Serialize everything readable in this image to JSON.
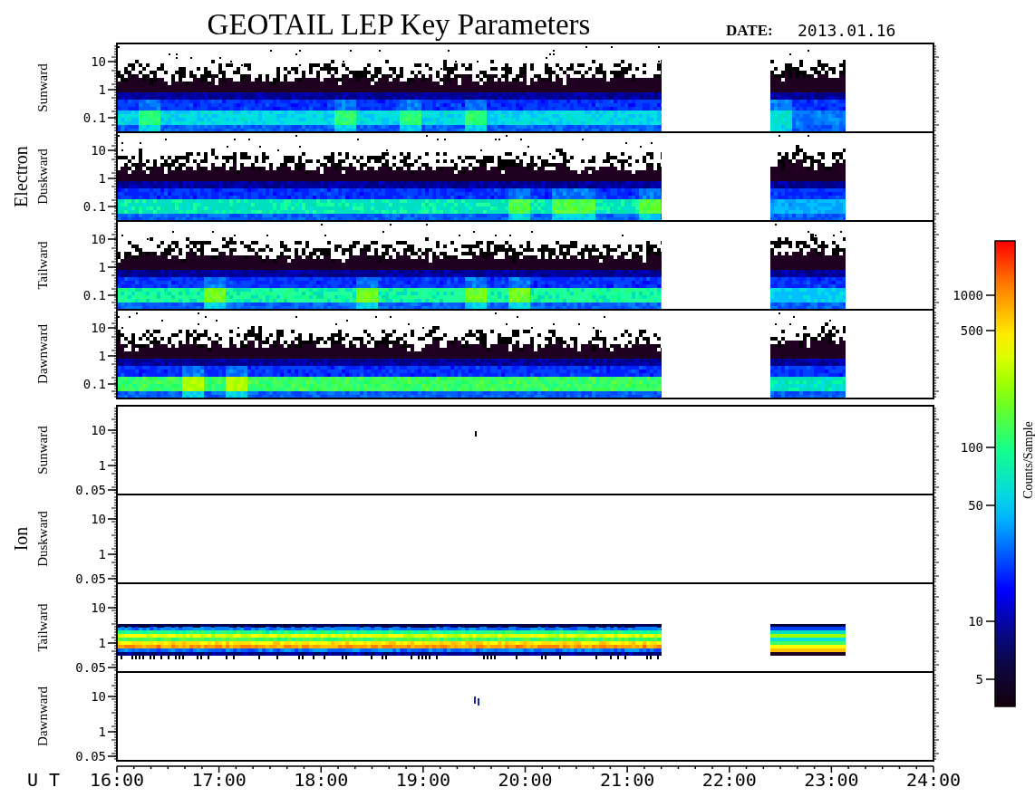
{
  "title": "GEOTAIL LEP Key Parameters",
  "date_label": "DATE:",
  "date": "2013.01.16",
  "groups": [
    {
      "label": "Electron",
      "panels": [
        {
          "label": "Sunward",
          "yticks": [
            "10",
            "1",
            "0.1"
          ]
        },
        {
          "label": "Duskward",
          "yticks": [
            "10",
            "1",
            "0.1"
          ]
        },
        {
          "label": "Tailward",
          "yticks": [
            "10",
            "1",
            "0.1"
          ]
        },
        {
          "label": "Dawnward",
          "yticks": [
            "10",
            "1",
            "0.1"
          ]
        }
      ]
    },
    {
      "label": "Ion",
      "panels": [
        {
          "label": "Sunward",
          "yticks": [
            "10",
            "1",
            "0.05"
          ]
        },
        {
          "label": "Duskward",
          "yticks": [
            "10",
            "1",
            "0.05"
          ]
        },
        {
          "label": "Tailward",
          "yticks": [
            "10",
            "1",
            "0.05"
          ]
        },
        {
          "label": "Dawnward",
          "yticks": [
            "10",
            "1",
            "0.05"
          ]
        }
      ]
    }
  ],
  "x_axis": {
    "label": "U T",
    "ticks": [
      "16:00",
      "17:00",
      "18:00",
      "19:00",
      "20:00",
      "21:00",
      "22:00",
      "23:00",
      "24:00"
    ]
  },
  "colorbar": {
    "label": "Counts/Sample",
    "ticks": [
      "1000",
      "500",
      "100",
      "50",
      "10",
      "5"
    ]
  }
}
